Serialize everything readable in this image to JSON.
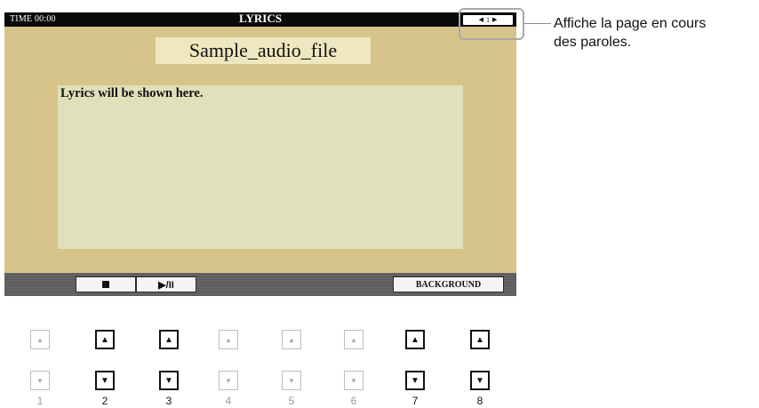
{
  "screen": {
    "time": "TIME 00:00",
    "title": "LYRICS",
    "page_indicator": {
      "prev_icon": "triangle-left",
      "page": "1",
      "next_icon": "triangle-right"
    },
    "song_title": "Sample_audio_file",
    "lyrics_text": "Lyrics will be shown here.",
    "buttons": {
      "stop_icon": "stop-square",
      "play_pause": "▶/II",
      "background": "BACKGROUND"
    }
  },
  "callout": {
    "line1": "Affiche la page en cours",
    "line2": "des paroles."
  },
  "panel": {
    "columns": [
      {
        "number": "1",
        "up_active": false,
        "down_active": false
      },
      {
        "number": "2",
        "up_active": true,
        "down_active": true
      },
      {
        "number": "3",
        "up_active": true,
        "down_active": true
      },
      {
        "number": "4",
        "up_active": false,
        "down_active": false
      },
      {
        "number": "5",
        "up_active": false,
        "down_active": false
      },
      {
        "number": "6",
        "up_active": false,
        "down_active": false
      },
      {
        "number": "7",
        "up_active": true,
        "down_active": true
      },
      {
        "number": "8",
        "up_active": true,
        "down_active": true
      }
    ]
  },
  "colors": {
    "screen_bg": "#d6c48a",
    "lyrics_area_bg": "#e0e1ba",
    "title_bg": "#efe7bf",
    "topbar": "#0a0a0a"
  }
}
